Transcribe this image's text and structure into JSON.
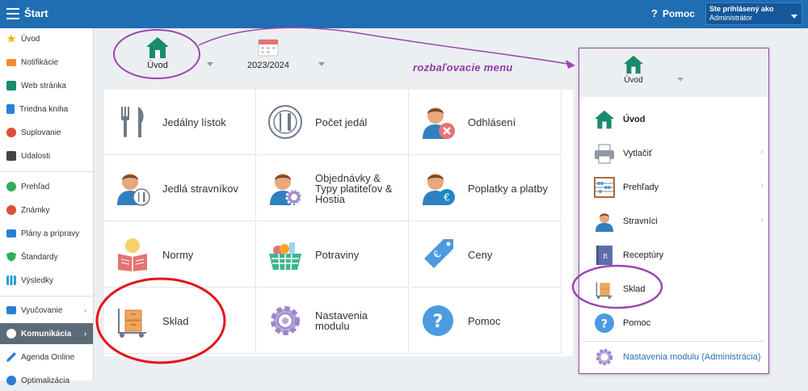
{
  "header": {
    "title": "Štart",
    "help_label": "Pomoc",
    "help_icon": "?",
    "user_label": "Ste prihlásený ako",
    "user_value": "Administrátor"
  },
  "sidebar": {
    "items": [
      {
        "label": "Úvod",
        "icon": "star-icon",
        "color": "#f4b400"
      },
      {
        "label": "Notifikácie",
        "icon": "envelope-icon",
        "color": "#f28c28"
      },
      {
        "label": "Web stránka",
        "icon": "home-icon",
        "color": "#1a8a6e"
      },
      {
        "label": "Triedna kniha",
        "icon": "book-icon",
        "color": "#2a7fd4"
      },
      {
        "label": "Suplovanie",
        "icon": "person-icon",
        "color": "#e04b3b"
      },
      {
        "label": "Udalosti",
        "icon": "calendar-icon",
        "color": "#444444"
      },
      {
        "label": "Prehľad",
        "icon": "check-icon",
        "color": "#2eae5a"
      },
      {
        "label": "Známky",
        "icon": "ban-icon",
        "color": "#e04b3b"
      },
      {
        "label": "Plány a prípravy",
        "icon": "briefcase-icon",
        "color": "#2a7fd4"
      },
      {
        "label": "Štandardy",
        "icon": "shield-icon",
        "color": "#2eae5a"
      },
      {
        "label": "Výsledky",
        "icon": "bar-chart-icon",
        "color": "#2a9fd4"
      },
      {
        "label": "Vyučovanie",
        "icon": "blackboard-icon",
        "color": "#2a7fd4",
        "arrow": "›"
      },
      {
        "label": "Komunikácia",
        "icon": "chat-icon",
        "color": "#ffffff",
        "arrow": "›"
      },
      {
        "label": "Agenda Online",
        "icon": "pen-icon",
        "color": "#2a7fd4"
      },
      {
        "label": "Optimalizácia",
        "icon": "gear-icon",
        "color": "#2a7fd4"
      }
    ]
  },
  "strip": {
    "home_label": "Úvod",
    "year_label": "2023/2024"
  },
  "annotation": "rozbaľovacie menu",
  "tiles": [
    {
      "label": "Jedálny lístok",
      "icon": "cutlery-icon"
    },
    {
      "label": "Počet jedál",
      "icon": "plate-icon"
    },
    {
      "label": "Odhlásení",
      "icon": "person-cancel-icon"
    },
    {
      "label": "Jedlá stravníkov",
      "icon": "person-cutlery-icon"
    },
    {
      "label": "Objednávky & Typy platiteľov & Hostia",
      "icon": "person-gear-icon"
    },
    {
      "label": "Poplatky a platby",
      "icon": "person-euro-icon"
    },
    {
      "label": "Normy",
      "icon": "reader-icon"
    },
    {
      "label": "Potraviny",
      "icon": "basket-icon"
    },
    {
      "label": "Ceny",
      "icon": "price-tag-icon"
    },
    {
      "label": "Sklad",
      "icon": "warehouse-trolley-icon"
    },
    {
      "label": "Nastavenia modulu",
      "icon": "gear-icon"
    },
    {
      "label": "Pomoc",
      "icon": "help-icon"
    }
  ],
  "dropdown": {
    "head_label": "Úvod",
    "items": [
      {
        "label": "Úvod",
        "icon": "home-icon",
        "bold": true
      },
      {
        "label": "Vytlačiť",
        "icon": "printer-icon",
        "chevron": "›"
      },
      {
        "label": "Prehľady",
        "icon": "abacus-icon",
        "chevron": "›"
      },
      {
        "label": "Stravníci",
        "icon": "person-icon",
        "chevron": "›"
      },
      {
        "label": "Receptúry",
        "icon": "recipe-book-icon"
      },
      {
        "label": "Sklad",
        "icon": "warehouse-trolley-icon"
      },
      {
        "label": "Pomoc",
        "icon": "help-icon"
      },
      {
        "label": "Nastavenia modulu (Administrácia)",
        "icon": "gear-icon"
      }
    ]
  },
  "colors": {
    "header": "#1f6db2",
    "annotation": "#8d3aa5",
    "red_circle": "#e3121d",
    "purple_circle": "#9c46b0"
  }
}
